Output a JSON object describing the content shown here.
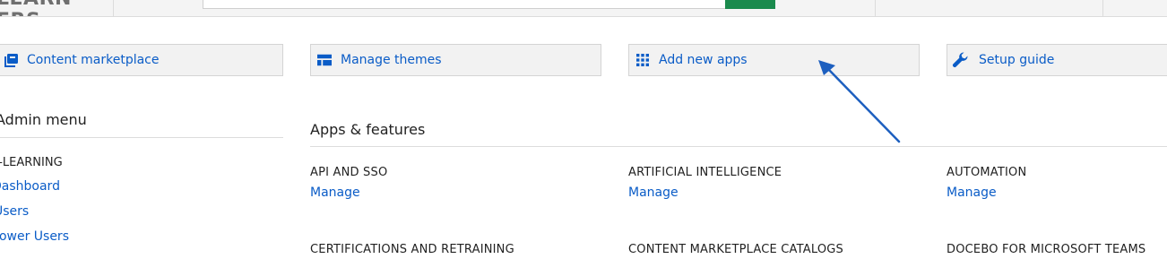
{
  "header": {
    "logo_text": "LEARN ERS"
  },
  "cards": [
    {
      "label": "Content marketplace",
      "icon": "marketplace-icon"
    },
    {
      "label": "Manage themes",
      "icon": "themes-icon"
    },
    {
      "label": "Add new apps",
      "icon": "apps-grid-icon"
    },
    {
      "label": "Setup guide",
      "icon": "wrench-icon"
    }
  ],
  "sidebar": {
    "title": "Admin menu",
    "section": "E-LEARNING",
    "links": [
      "Dashboard",
      "Users",
      "Power Users"
    ]
  },
  "main": {
    "title": "Apps & features",
    "apps": [
      {
        "name": "API AND SSO",
        "action": "Manage"
      },
      {
        "name": "ARTIFICIAL INTELLIGENCE",
        "action": "Manage"
      },
      {
        "name": "AUTOMATION",
        "action": "Manage"
      },
      {
        "name": "CERTIFICATIONS AND RETRAINING"
      },
      {
        "name": "CONTENT MARKETPLACE CATALOGS"
      },
      {
        "name": "DOCEBO FOR MICROSOFT TEAMS"
      }
    ]
  },
  "colors": {
    "link": "#0a5cc7",
    "card_bg": "#f2f2f2",
    "annotation_arrow": "#1d5fbf",
    "search_button": "#1a8a4d"
  }
}
